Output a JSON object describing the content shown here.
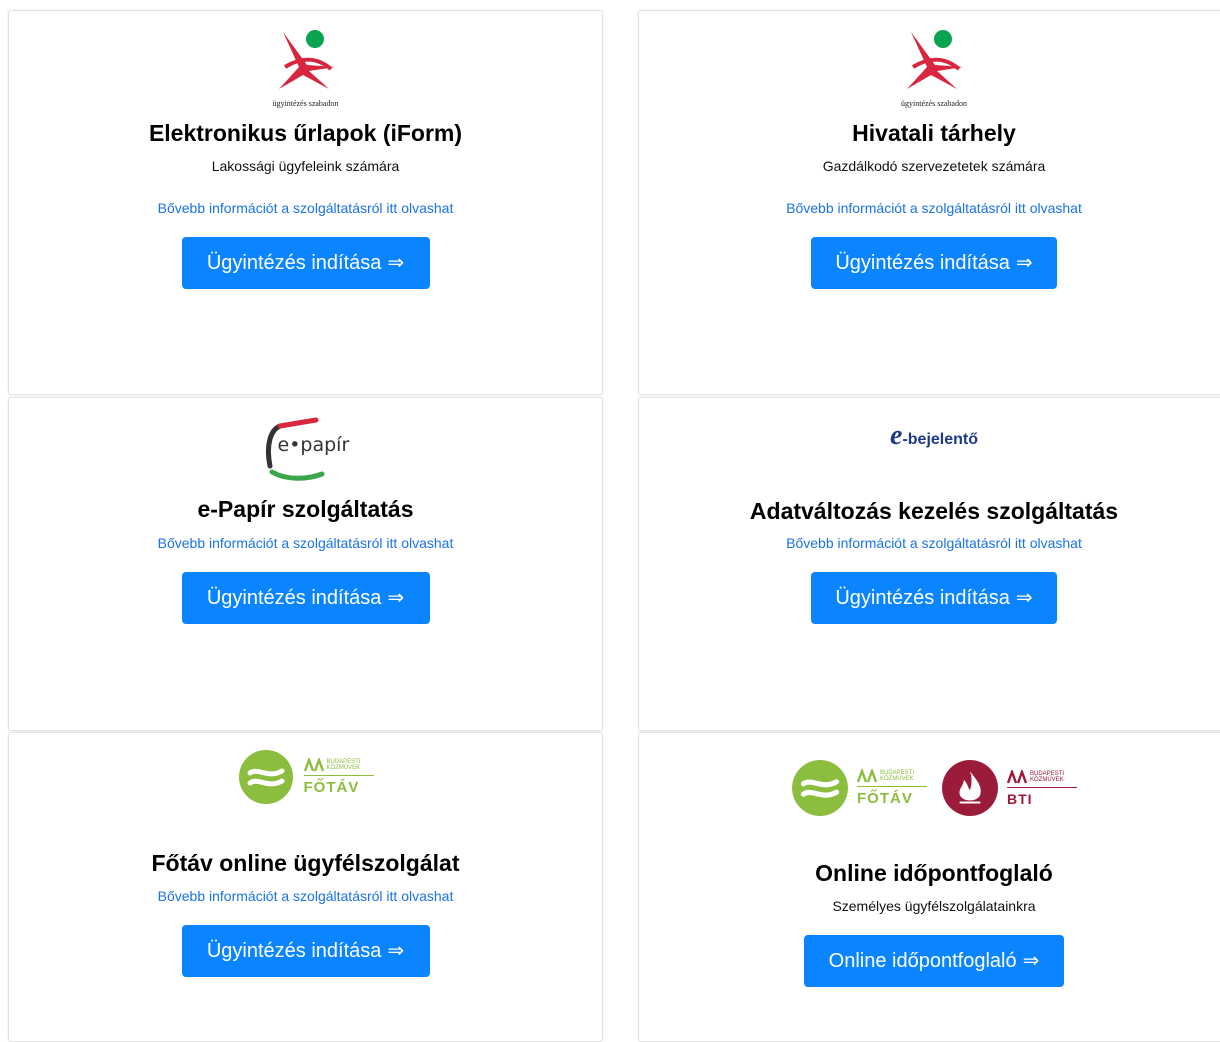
{
  "cards": [
    {
      "logo_caption": "ügyintézés szabadon",
      "title": "Elektronikus űrlapok (iForm)",
      "subtitle": "Lakossági ügyfeleink számára",
      "link": "Bővebb információt a szolgáltatásról itt olvashat",
      "button": "Ügyintézés indítása",
      "button_arrow": "⇒"
    },
    {
      "logo_caption": "ügyintézés szabadon",
      "title": "Hivatali tárhely",
      "subtitle": "Gazdálkodó szervezetetek számára",
      "link": "Bővebb információt a szolgáltatásról itt olvashat",
      "button": "Ügyintézés indítása",
      "button_arrow": "⇒"
    },
    {
      "logo_text": "e•papír",
      "title": "e-Papír szolgáltatás",
      "link": "Bővebb információt a szolgáltatásról itt olvashat",
      "button": "Ügyintézés indítása",
      "button_arrow": "⇒"
    },
    {
      "logo_e": "e",
      "logo_text": "-bejelentő",
      "title": "Adatváltozás kezelés szolgáltatás",
      "link": "Bővebb információt a szolgáltatásról itt olvashat",
      "button": "Ügyintézés indítása",
      "button_arrow": "⇒"
    },
    {
      "logo_text": "FŐTÁV",
      "logo_small_1": "BUDAPESTI",
      "logo_small_2": "KÖZMŰVEK",
      "title": "Főtáv online ügyfélszolgálat",
      "link": "Bővebb információt a szolgáltatásról itt olvashat",
      "button": "Ügyintézés indítása",
      "button_arrow": "⇒"
    },
    {
      "logo_text_fotav": "FŐTÁV",
      "logo_text_bti": "BTI",
      "logo_small_1": "BUDAPESTI",
      "logo_small_2": "KÖZMŰVEK",
      "title": "Online időpontfoglaló",
      "subtitle": "Személyes ügyfélszolgálatainkra",
      "button": "Online időpontfoglaló",
      "button_arrow": "⇒"
    }
  ],
  "colors": {
    "button_bg": "#0a84ff",
    "link": "#1a73e8",
    "logo_red": "#d7263d",
    "logo_green": "#0aa34f",
    "fotav_green": "#8bbd3e",
    "bti_red": "#9a1b3a"
  }
}
